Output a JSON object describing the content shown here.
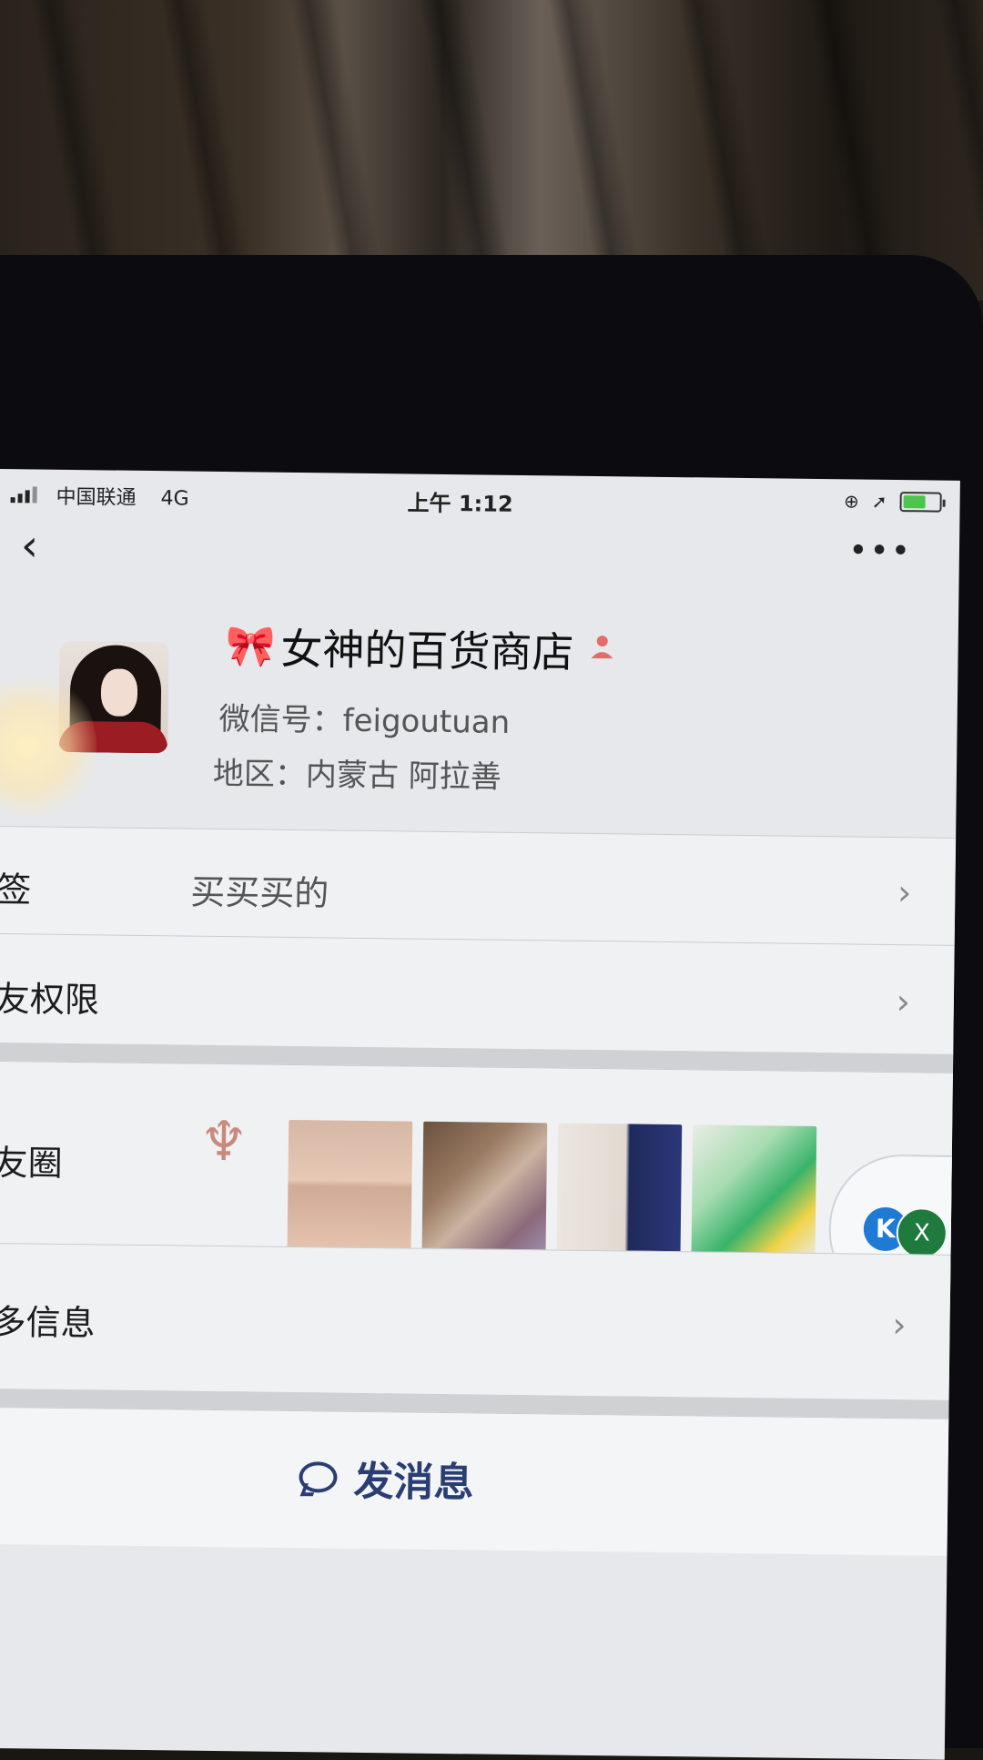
{
  "status_bar": {
    "carrier": "中国联通",
    "network": "4G",
    "time": "上午 1:12"
  },
  "header": {
    "back_icon": "chevron-left-icon",
    "more_label": "•••"
  },
  "profile": {
    "name_prefix_icon": "ribbon-bow",
    "name_prefix": "🎀",
    "name": "女神的百货商店",
    "gender_icon": "female-user-icon",
    "wechat_id": "微信号：feigoutuan",
    "region": "地区：内蒙古 阿拉善"
  },
  "rows": {
    "tags": {
      "label": "标签",
      "value": "买买买的"
    },
    "friend_permissions": {
      "label": "朋友权限"
    },
    "moments": {
      "label": "朋友圈"
    },
    "more_info": {
      "label": "更多信息"
    }
  },
  "actions": {
    "send_message": "发消息"
  },
  "floating_widget": {
    "k_label": "K",
    "x_label": "X"
  },
  "colors": {
    "send_text": "#2a3e73",
    "bow": "#e2607e",
    "gender_icon": "#e56b6b"
  }
}
